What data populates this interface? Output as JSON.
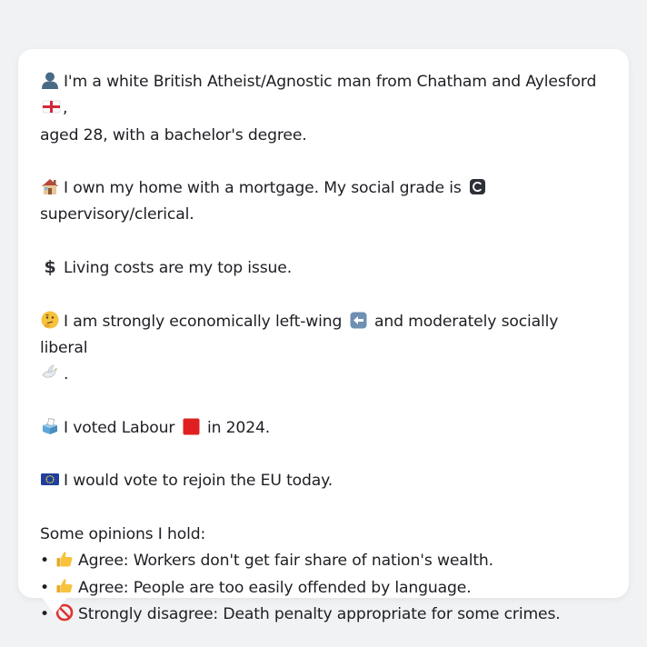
{
  "profile": {
    "identity_text": "I'm a white British Atheist/Agnostic man from Chatham and Aylesford",
    "identity_suffix": ",",
    "identity_line2": "aged 28, with a bachelor's degree.",
    "home_text": "I own my home with a mortgage. My social grade is",
    "home_line2": "supervisory/clerical.",
    "issue_text": "Living costs are my top issue.",
    "ideology_text_a": "I am strongly economically left-wing",
    "ideology_text_b": "and moderately socially liberal",
    "ideology_end": ".",
    "vote_text_a": "I voted Labour",
    "vote_text_b": "in 2024.",
    "eu_text": "I would vote to rejoin the EU today.",
    "opinions_heading": "Some opinions I hold:",
    "bullet_char": "•",
    "opinions": [
      {
        "text": "Agree: Workers don't get fair share of nation's wealth.",
        "icon": "thumbs-up-icon"
      },
      {
        "text": "Agree: People are too easily offended by language.",
        "icon": "thumbs-up-icon"
      },
      {
        "text": "Strongly disagree: Death penalty appropriate for some crimes.",
        "icon": "prohibited-icon"
      }
    ]
  },
  "icons": {
    "person": "bust-silhouette-icon",
    "england_flag": "england-flag-icon",
    "house": "house-icon",
    "grade_c": "letter-c-badge-icon",
    "dollar": "dollar-sign-icon",
    "thinking": "thinking-face-icon",
    "left_arrow": "left-arrow-icon",
    "dove": "dove-icon",
    "ballot": "ballot-box-icon",
    "red_square": "red-square-icon",
    "eu_flag": "eu-flag-icon"
  },
  "colors": {
    "background": "#f1f2f4",
    "bubble": "#ffffff",
    "text": "#1e1e24",
    "labour_red": "#e02020",
    "eu_blue": "#1f3f9e"
  }
}
